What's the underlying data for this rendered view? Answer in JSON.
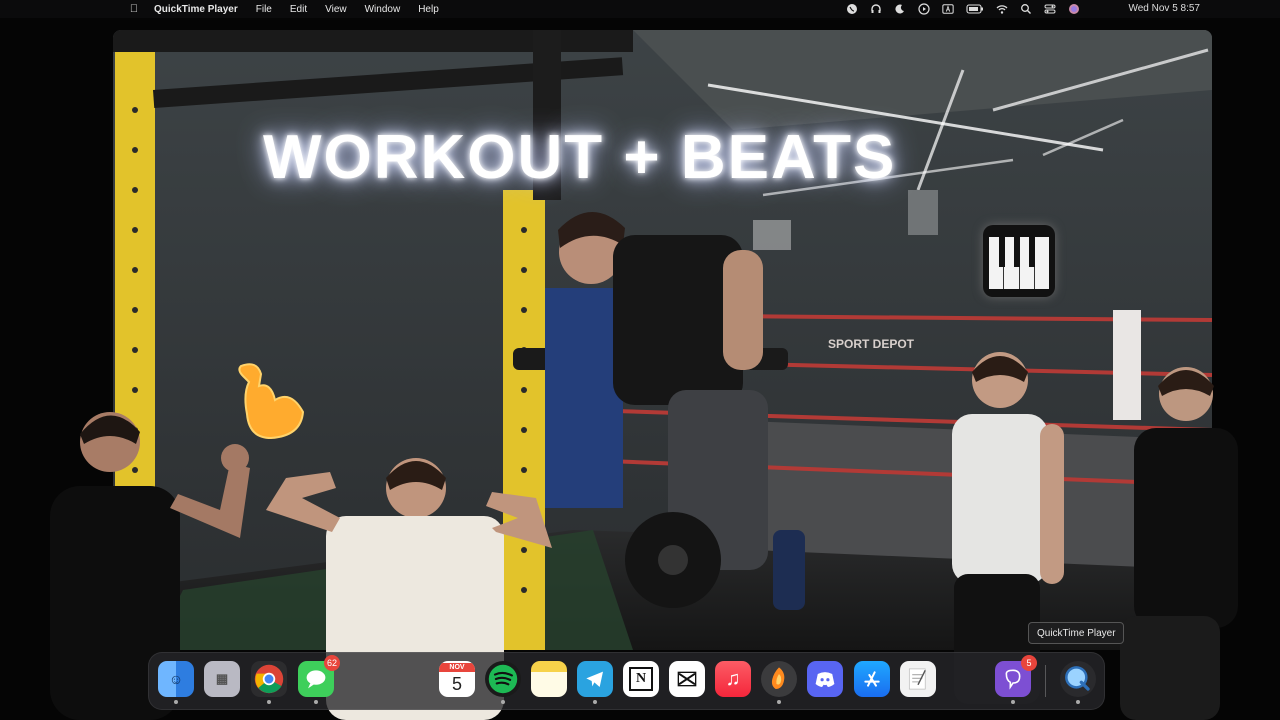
{
  "menubar": {
    "app_name": "QuickTime Player",
    "menus": [
      "File",
      "Edit",
      "View",
      "Window",
      "Help"
    ],
    "clock": "Wed Nov 5  8:57"
  },
  "video": {
    "title_text": "WORKOUT + BEATS",
    "ring_banner": "SPORT DEPOT"
  },
  "dock": {
    "items": [
      {
        "name": "Finder",
        "icon": "finder-icon",
        "color": "#3b8ef0"
      },
      {
        "name": "Launchpad",
        "icon": "launchpad-icon",
        "color": "#b9b9c3"
      },
      {
        "name": "Google Chrome",
        "icon": "chrome-icon",
        "color": "#e9e9e9"
      },
      {
        "name": "Messages",
        "icon": "messages-icon",
        "color": "#3ecf5b",
        "badge": "62"
      },
      {
        "name": "Calendar",
        "icon": "calendar-icon",
        "color": "#ffffff",
        "month": "NOV",
        "day": "5"
      },
      {
        "name": "Spotify",
        "icon": "spotify-icon",
        "color": "#1db954"
      },
      {
        "name": "Notes",
        "icon": "notes-icon",
        "color": "#fff6c8"
      },
      {
        "name": "Telegram",
        "icon": "telegram-icon",
        "color": "#2aa3e0"
      },
      {
        "name": "Notion",
        "icon": "notion-icon",
        "color": "#ffffff"
      },
      {
        "name": "CapCut",
        "icon": "capcut-icon",
        "color": "#ffffff"
      },
      {
        "name": "Music",
        "icon": "music-icon",
        "color": "#fa3c4c"
      },
      {
        "name": "FL Studio",
        "icon": "fl-studio-icon",
        "color": "#ff8a1e"
      },
      {
        "name": "Discord",
        "icon": "discord-icon",
        "color": "#5865f2"
      },
      {
        "name": "App Store",
        "icon": "app-store-icon",
        "color": "#1b8cf5"
      },
      {
        "name": "TextEdit",
        "icon": "textedit-icon",
        "color": "#f2f2f2"
      },
      {
        "name": "Viber",
        "icon": "viber-icon",
        "color": "#7d4fd3",
        "badge": "5"
      },
      {
        "name": "QuickTime Player",
        "icon": "quicktime-icon",
        "color": "#2d6fb8"
      }
    ]
  },
  "tooltip": "QuickTime Player"
}
